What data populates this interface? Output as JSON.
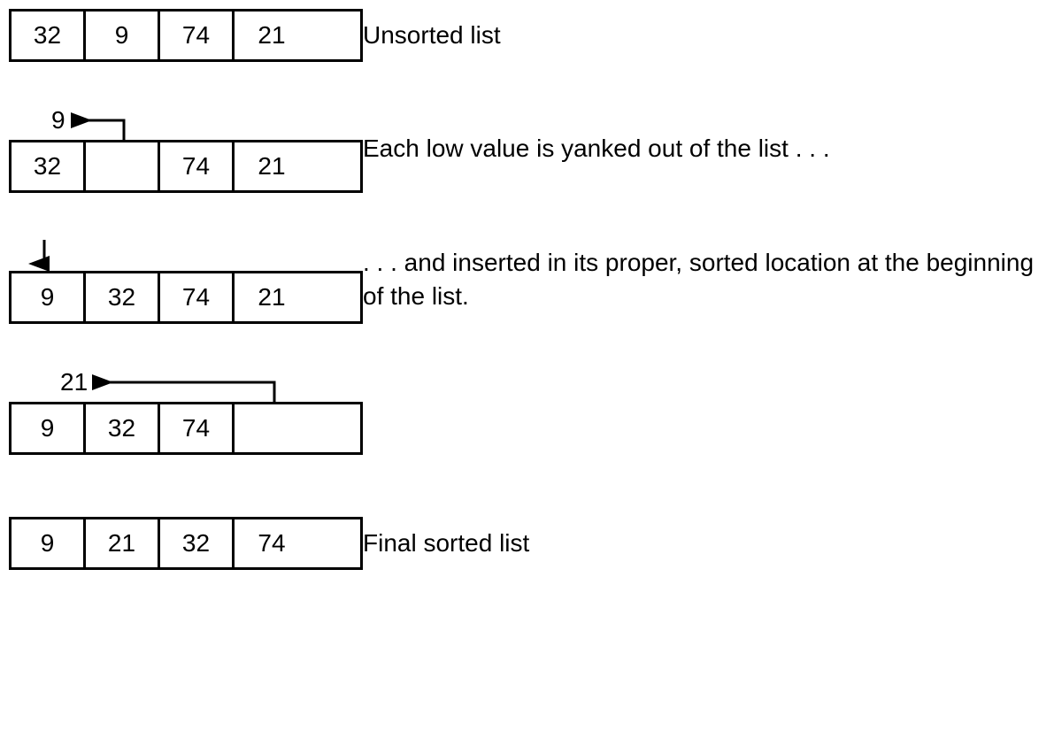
{
  "steps": [
    {
      "cells": [
        "32",
        "9",
        "74",
        "21"
      ],
      "desc": "Unsorted list",
      "annotation": null
    },
    {
      "cells": [
        "32",
        "",
        "74",
        "21"
      ],
      "desc": "Each low value is yanked out of the list . . .",
      "annotation": {
        "type": "yank-right",
        "label": "9",
        "labelX": 48,
        "arrowStartX": 130,
        "arrowEndX": 90
      }
    },
    {
      "cells": [
        "9",
        "32",
        "74",
        "21"
      ],
      "desc": ". . . and inserted in its proper, sorted location at the beginning of the list.",
      "annotation": {
        "type": "insert-down",
        "arrowX": 40
      }
    },
    {
      "cells": [
        "9",
        "32",
        "74",
        ""
      ],
      "desc": "",
      "annotation": {
        "type": "yank-far",
        "label": "21",
        "labelX": 60,
        "arrowStartX": 300,
        "arrowEndX": 110
      }
    },
    {
      "cells": [
        "9",
        "21",
        "32",
        "74"
      ],
      "desc": "Final sorted list",
      "annotation": null
    }
  ]
}
